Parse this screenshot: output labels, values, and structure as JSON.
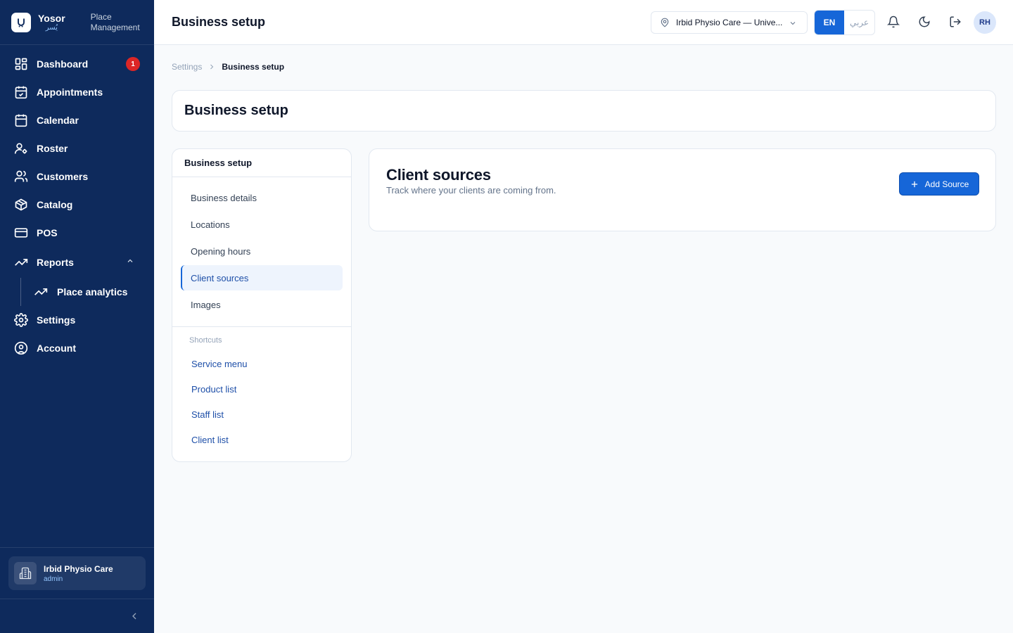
{
  "brand": {
    "name": "Yosor",
    "name_ar": "يُسر",
    "subtitle_line1": "Place",
    "subtitle_line2": "Management"
  },
  "sidebar": {
    "items": [
      {
        "label": "Dashboard",
        "badge": "1"
      },
      {
        "label": "Appointments"
      },
      {
        "label": "Calendar"
      },
      {
        "label": "Roster"
      },
      {
        "label": "Customers"
      },
      {
        "label": "Catalog"
      },
      {
        "label": "POS"
      },
      {
        "label": "Reports"
      },
      {
        "label": "Place analytics"
      },
      {
        "label": "Settings"
      },
      {
        "label": "Account"
      }
    ],
    "place": {
      "name": "Irbid Physio Care",
      "role": "admin"
    }
  },
  "header": {
    "title": "Business setup",
    "location": "Irbid Physio Care — Unive...",
    "lang_en": "EN",
    "lang_ar": "عربي",
    "avatar_initials": "RH"
  },
  "breadcrumb": {
    "parent": "Settings",
    "current": "Business setup"
  },
  "page": {
    "title": "Business setup"
  },
  "settings_nav": {
    "heading": "Business setup",
    "items": [
      "Business details",
      "Locations",
      "Opening hours",
      "Client sources",
      "Images"
    ],
    "active_index": 3,
    "shortcuts_label": "Shortcuts",
    "shortcuts": [
      "Service menu",
      "Product list",
      "Staff list",
      "Client list"
    ]
  },
  "content": {
    "title": "Client sources",
    "subtitle": "Track where your clients are coming from.",
    "add_button": "Add Source"
  },
  "colors": {
    "sidebar_bg": "#0e2a5c",
    "accent": "#1666d8",
    "badge": "#dc2626"
  }
}
